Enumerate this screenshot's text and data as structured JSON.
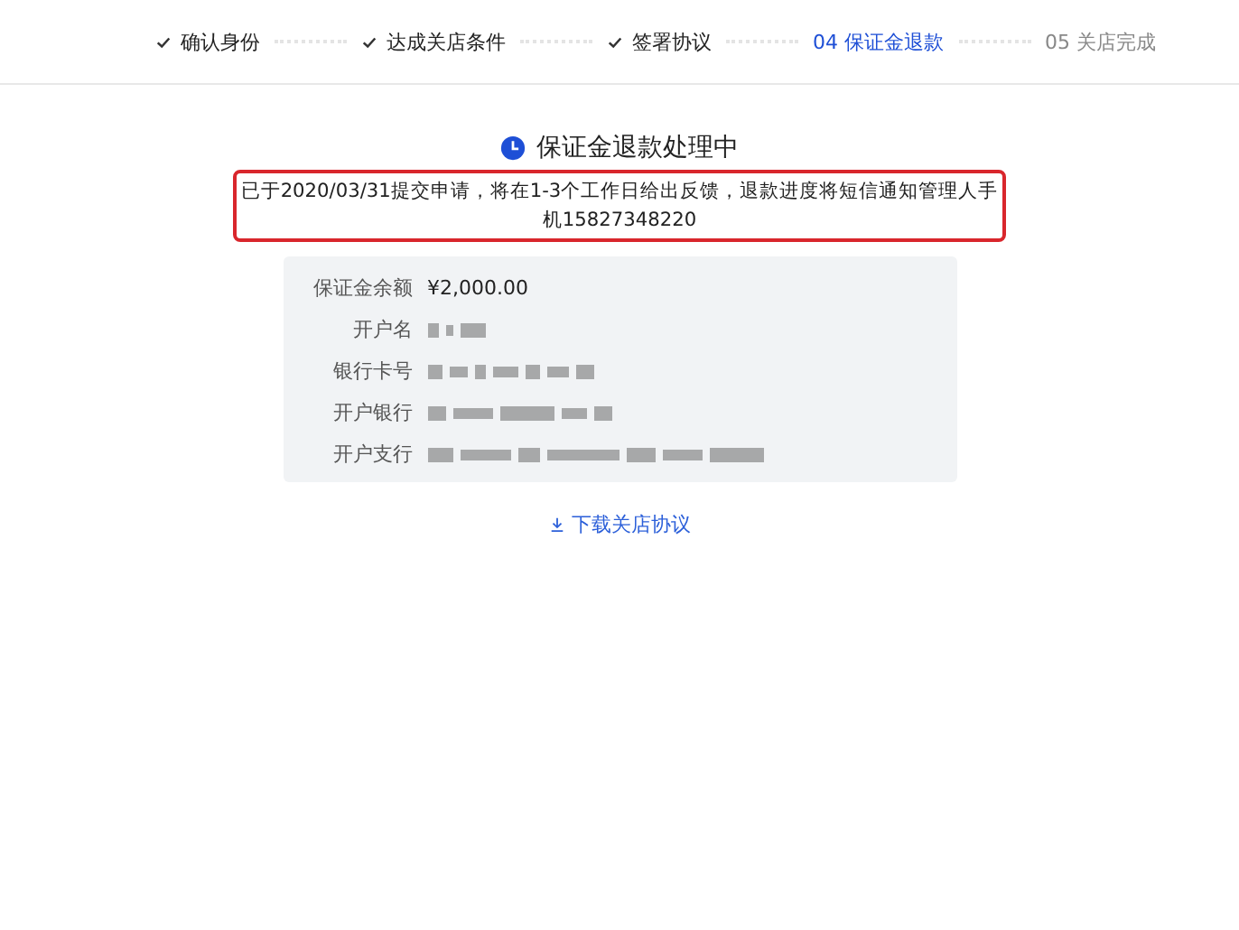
{
  "steps": [
    {
      "label": "确认身份",
      "completed": true,
      "selected": false
    },
    {
      "label": "达成关店条件",
      "completed": true,
      "selected": false
    },
    {
      "label": "签署协议",
      "completed": true,
      "selected": false
    },
    {
      "label": "04 保证金退款",
      "completed": false,
      "selected": true
    },
    {
      "label": "05 关店完成",
      "completed": false,
      "selected": false
    }
  ],
  "status": {
    "title": "保证金退款处理中",
    "notice": "已于2020/03/31提交申请，将在1-3个工作日给出反馈，退款进度将短信通知管理人手机15827348220",
    "highlighted": true
  },
  "details": [
    {
      "label": "保证金余额",
      "kind": "text",
      "value": "¥2,000.00"
    },
    {
      "label": "开户名",
      "kind": "redacted"
    },
    {
      "label": "银行卡号",
      "kind": "redacted"
    },
    {
      "label": "开户银行",
      "kind": "redacted"
    },
    {
      "label": "开户支行",
      "kind": "redacted"
    }
  ],
  "download_link": "下载关店协议"
}
